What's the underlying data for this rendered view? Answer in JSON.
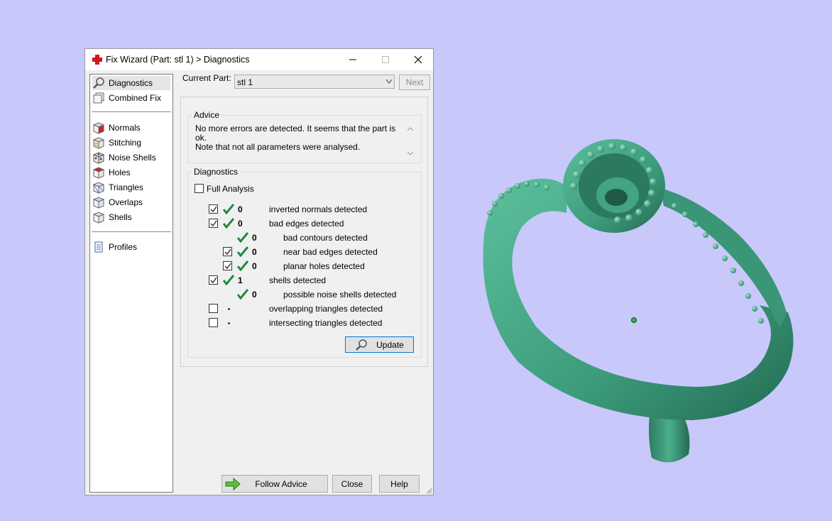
{
  "window": {
    "title": "Fix Wizard (Part: stl 1) > Diagnostics",
    "minimize_label": "─",
    "maximize_label": "☐",
    "close_label": "✕"
  },
  "sidebar": {
    "items": [
      {
        "label": "Diagnostics",
        "icon": "magnifier-icon"
      },
      {
        "label": "Combined Fix",
        "icon": "combined-fix-icon"
      },
      {
        "label": "Normals",
        "icon": "normals-cube-icon"
      },
      {
        "label": "Stitching",
        "icon": "stitching-cube-icon"
      },
      {
        "label": "Noise Shells",
        "icon": "noise-shells-icon"
      },
      {
        "label": "Holes",
        "icon": "holes-cube-icon"
      },
      {
        "label": "Triangles",
        "icon": "triangles-cube-icon"
      },
      {
        "label": "Overlaps",
        "icon": "overlaps-cube-icon"
      },
      {
        "label": "Shells",
        "icon": "shells-cube-icon"
      },
      {
        "label": "Profiles",
        "icon": "profiles-document-icon"
      }
    ]
  },
  "current_part": {
    "label": "Current Part:",
    "value": "stl 1"
  },
  "next_button": "Next",
  "advice": {
    "title": "Advice",
    "text": "No more errors are detected. It seems that the part is ok.\nNote that not all parameters were analysed."
  },
  "diagnostics": {
    "title": "Diagnostics",
    "full_analysis_label": "Full Analysis",
    "full_analysis_checked": false,
    "rows": [
      {
        "checkbox": "checked",
        "status": "ok",
        "count": "0",
        "label": "inverted normals detected",
        "indent": 0
      },
      {
        "checkbox": "checked",
        "status": "ok",
        "count": "0",
        "label": "bad edges detected",
        "indent": 0
      },
      {
        "checkbox": "none",
        "status": "ok",
        "count": "0",
        "label": "bad contours detected",
        "indent": 1
      },
      {
        "checkbox": "checked",
        "status": "ok",
        "count": "0",
        "label": "near bad edges detected",
        "indent": 1
      },
      {
        "checkbox": "checked",
        "status": "ok",
        "count": "0",
        "label": "planar holes detected",
        "indent": 1
      },
      {
        "checkbox": "checked",
        "status": "ok",
        "count": "1",
        "label": "shells detected",
        "indent": 0
      },
      {
        "checkbox": "none",
        "status": "ok",
        "count": "0",
        "label": "possible noise shells detected",
        "indent": 1
      },
      {
        "checkbox": "unchecked",
        "status": "pending",
        "count": "",
        "label": "overlapping triangles detected",
        "indent": 0
      },
      {
        "checkbox": "unchecked",
        "status": "pending",
        "count": "",
        "label": "intersecting triangles detected",
        "indent": 0
      }
    ],
    "update_button": "Update"
  },
  "footer": {
    "follow_advice": "Follow Advice",
    "close": "Close",
    "help": "Help"
  },
  "colors": {
    "background": "#c8c8fb",
    "model": "#3e9a7c",
    "check": "#1f8a3a"
  }
}
